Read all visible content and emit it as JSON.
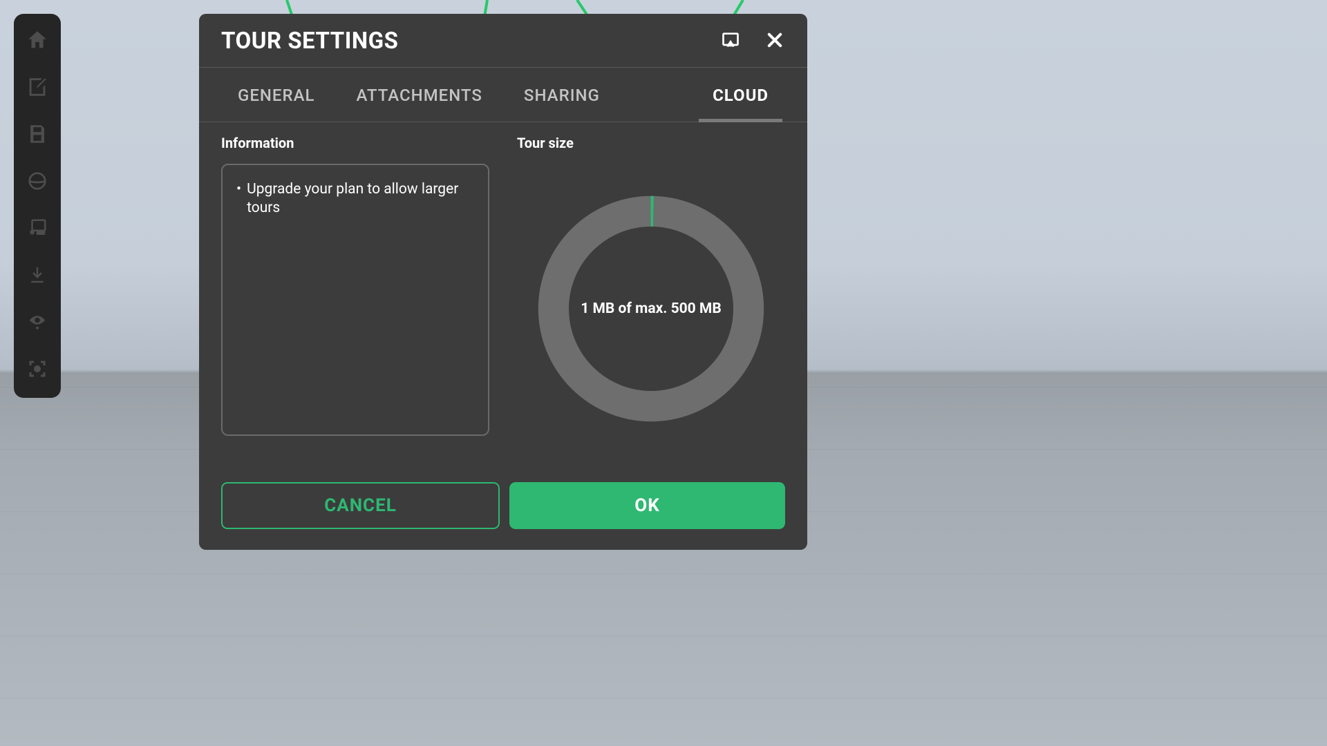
{
  "dialog": {
    "title": "TOUR SETTINGS",
    "tabs": {
      "general": "GENERAL",
      "attachments": "ATTACHMENTS",
      "sharing": "SHARING",
      "cloud": "CLOUD"
    },
    "info_label": "Information",
    "info_bullet": "Upgrade your plan to allow larger tours",
    "size_label": "Tour size",
    "size_text": "1 MB of max. 500 MB",
    "cancel_label": "CANCEL",
    "ok_label": "OK"
  },
  "colors": {
    "accent": "#2eb872"
  },
  "gauge": {
    "used_mb": 1,
    "max_mb": 500
  }
}
